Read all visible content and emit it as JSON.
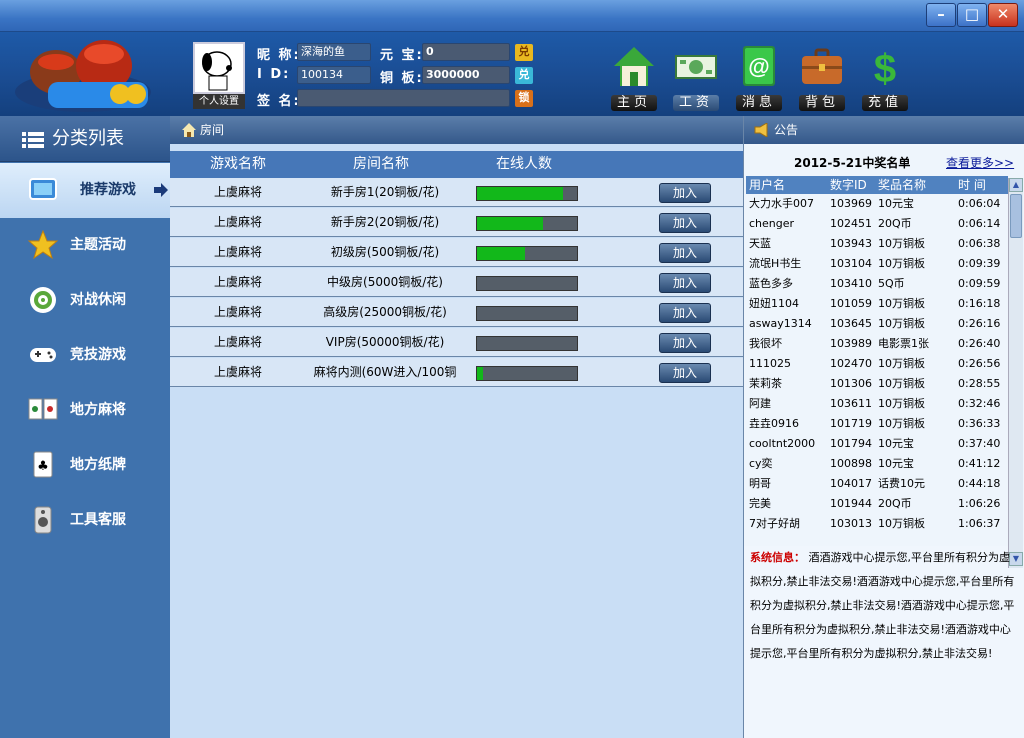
{
  "window": {
    "controls": [
      "–",
      "□",
      "✕"
    ]
  },
  "colors": {
    "accent": "#4677b8",
    "bar_fill": "#12b81a",
    "sys_label": "#cc0000"
  },
  "profile": {
    "avatar_button": "个人设置",
    "nickname_label": "昵 称:",
    "nickname": "深海的鱼",
    "id_label": "I D:",
    "id": "100134",
    "signature_label": "签 名:",
    "signature": "",
    "yuanbao_label": "元 宝:",
    "yuanbao": "0",
    "yuanbao_action": "兑",
    "tongban_label": "铜 板:",
    "tongban": "3000000",
    "tongban_action": "兑",
    "lock_action": "锁"
  },
  "toolbar": [
    {
      "label": "主页",
      "icon": "house-icon"
    },
    {
      "label": "工资",
      "icon": "money-icon"
    },
    {
      "label": "消息",
      "icon": "at-icon"
    },
    {
      "label": "背包",
      "icon": "briefcase-icon"
    },
    {
      "label": "充值",
      "icon": "dollar-icon"
    }
  ],
  "sidebar": {
    "title": "分类列表",
    "items": [
      {
        "label": "推荐游戏",
        "icon": "tv-icon"
      },
      {
        "label": "主题活动",
        "icon": "star-icon"
      },
      {
        "label": "对战休闲",
        "icon": "target-icon"
      },
      {
        "label": "竞技游戏",
        "icon": "gamepad-icon"
      },
      {
        "label": "地方麻将",
        "icon": "mahjong-icon"
      },
      {
        "label": "地方纸牌",
        "icon": "card-icon"
      },
      {
        "label": "工具客服",
        "icon": "speaker-icon"
      }
    ]
  },
  "rooms": {
    "title": "房间",
    "headers": [
      "游戏名称",
      "房间名称",
      "在线人数"
    ],
    "rows": [
      {
        "game": "上虞麻将",
        "room": "新手房1(20铜板/花)",
        "online": 0.86,
        "action": "加入"
      },
      {
        "game": "上虞麻将",
        "room": "新手房2(20铜板/花)",
        "online": 0.66,
        "action": "加入"
      },
      {
        "game": "上虞麻将",
        "room": "初级房(500铜板/花)",
        "online": 0.48,
        "action": "加入"
      },
      {
        "game": "上虞麻将",
        "room": "中级房(5000铜板/花)",
        "online": 0.0,
        "action": "加入"
      },
      {
        "game": "上虞麻将",
        "room": "高级房(25000铜板/花)",
        "online": 0.0,
        "action": "加入"
      },
      {
        "game": "上虞麻将",
        "room": "VIP房(50000铜板/花)",
        "online": 0.0,
        "action": "加入"
      },
      {
        "game": "上虞麻将",
        "room": "麻将内测(60W进入/100铜",
        "online": 0.06,
        "action": "加入"
      }
    ]
  },
  "notice": {
    "title": "公告",
    "winners_title": "2012-5-21中奖名单",
    "more": "查看更多>>",
    "headers": [
      "用户名",
      "数字ID",
      "奖品名称",
      "时 间"
    ],
    "rows": [
      [
        "大力水手007",
        "103969",
        "10元宝",
        "0:06:04"
      ],
      [
        "chenger",
        "102451",
        "20Q币",
        "0:06:14"
      ],
      [
        "天蓝",
        "103943",
        "10万铜板",
        "0:06:38"
      ],
      [
        "流氓H书生",
        "103104",
        "10万铜板",
        "0:09:39"
      ],
      [
        "蓝色多多",
        "103410",
        "5Q币",
        "0:09:59"
      ],
      [
        "妞妞1104",
        "101059",
        "10万铜板",
        "0:16:18"
      ],
      [
        "asway1314",
        "103645",
        "10万铜板",
        "0:26:16"
      ],
      [
        "我很坏",
        "103989",
        "电影票1张",
        "0:26:40"
      ],
      [
        "111025",
        "102470",
        "10万铜板",
        "0:26:56"
      ],
      [
        "茉莉茶",
        "101306",
        "10万铜板",
        "0:28:55"
      ],
      [
        "阿建",
        "103611",
        "10万铜板",
        "0:32:46"
      ],
      [
        "垚垚0916",
        "101719",
        "10万铜板",
        "0:36:33"
      ],
      [
        "cooltnt2000",
        "101794",
        "10元宝",
        "0:37:40"
      ],
      [
        "cy奕",
        "100898",
        "10元宝",
        "0:41:12"
      ],
      [
        "明哥",
        "104017",
        "话费10元",
        "0:44:18"
      ],
      [
        "完美",
        "101944",
        "20Q币",
        "1:06:26"
      ],
      [
        "7对子好胡",
        "103013",
        "10万铜板",
        "1:06:37"
      ]
    ],
    "sys_label": "系统信息：",
    "sys_text": "酒酒游戏中心提示您,平台里所有积分为虚拟积分,禁止非法交易!酒酒游戏中心提示您,平台里所有积分为虚拟积分,禁止非法交易!酒酒游戏中心提示您,平台里所有积分为虚拟积分,禁止非法交易!酒酒游戏中心提示您,平台里所有积分为虚拟积分,禁止非法交易!"
  }
}
